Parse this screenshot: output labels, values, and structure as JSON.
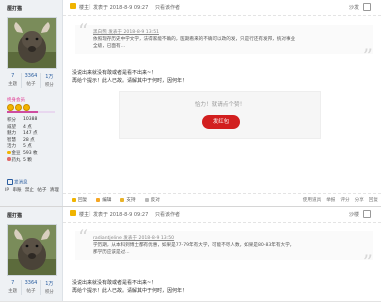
{
  "posts": [
    {
      "user": {
        "name": "厘打猫",
        "stats": [
          {
            "value": "7",
            "label": "主题"
          },
          {
            "value": "3364",
            "label": "帖子"
          },
          {
            "value": "1万",
            "label": "积分"
          }
        ],
        "group": "终身会员",
        "level_fill": 0.65,
        "props": [
          {
            "k": "积分",
            "v": "10388"
          },
          {
            "k": "威望",
            "v": "4 点"
          },
          {
            "k": "魅力",
            "v": "147 点"
          },
          {
            "k": "智慧",
            "v": "28 点"
          },
          {
            "k": "活力",
            "v": "5 点"
          },
          {
            "k": "金豆",
            "v": "593 枚"
          },
          {
            "k": "药丸",
            "v": "5 颗"
          }
        ],
        "online": "发消息",
        "actions": [
          "IP",
          "串账",
          "禁止",
          "帖子",
          "清理"
        ]
      },
      "meta": {
        "landlord": "楼主",
        "sep": "|",
        "date": "发表于 2018-8-9 09:27",
        "author": "只看该作者",
        "floor": "沙发"
      },
      "quote": {
        "head": "黑白熊 发表于 2018-8-9 13:51",
        "lines": [
          "依照现存历史中学文学，法得家能不确的，医期看来的不确可以政的发，只是行还有发邦，统对事业",
          "全级，已面有…"
        ]
      },
      "body": [
        "没说出来就没有敢或者是看不出来~！",
        "再给个提示！此人已故。请解其中于何时，因何年！"
      ],
      "reward": {
        "message": "恰力！就请点个赞！",
        "button": "发红包"
      },
      "actions_left": [
        "回复",
        "编辑",
        "支持",
        "反对"
      ],
      "actions_right": [
        "使用道具",
        "举报",
        "评分",
        "分享",
        "回复"
      ]
    },
    {
      "user": {
        "name": "厘打猫",
        "stats": [
          {
            "value": "7",
            "label": "主题"
          },
          {
            "value": "3364",
            "label": "帖子"
          },
          {
            "value": "1万",
            "label": "积分"
          }
        ]
      },
      "meta": {
        "landlord": "楼主",
        "sep": "|",
        "date": "发表于 2018-8-9 09:27",
        "author": "只看该作者",
        "floor": "沙楼"
      },
      "quote": {
        "head": "radiantjeline 发表于 2018-8-9 13:50",
        "lines": [
          "学历期，从本科到博士都有优惠，如果是77-79年有大学，可能不尽人数，如果是80-83年有大学，",
          "那学历应该是过..."
        ]
      },
      "body": [
        "没说出来就没有敢或者是看不出来~！",
        "再给个提示！此人已故。请解其中于何时，因何年！"
      ]
    }
  ]
}
